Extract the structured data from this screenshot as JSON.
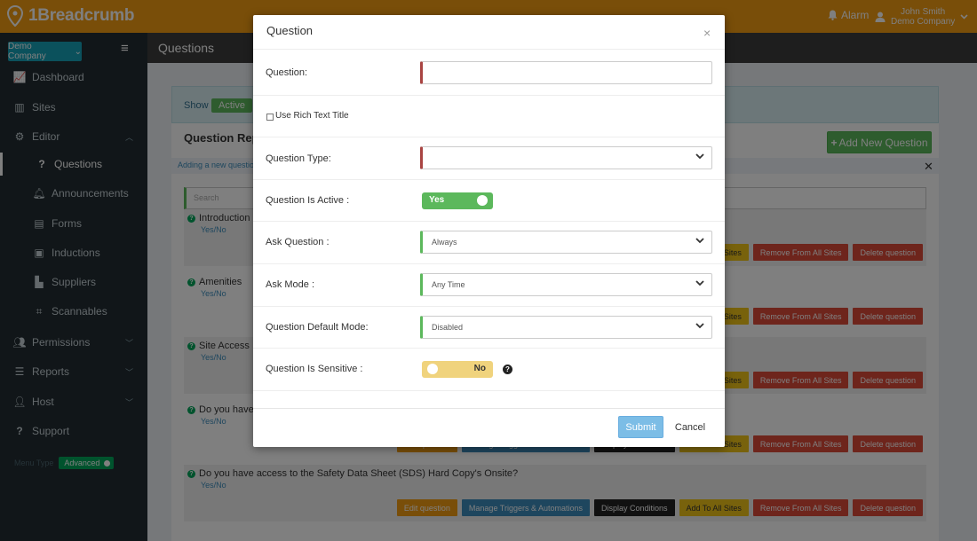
{
  "app": {
    "logo_text": "1Breadcrumb",
    "alarm_label": "Alarm",
    "user_name": "John Smith",
    "user_company": "Demo Company",
    "brand_color": "#f39c12"
  },
  "sidebar": {
    "company_selector": "Demo Company",
    "items": [
      {
        "label": "Dashboard",
        "icon": "chart-icon"
      },
      {
        "label": "Sites",
        "icon": "building-icon"
      },
      {
        "label": "Editor",
        "icon": "gear-icon"
      },
      {
        "label": "Questions",
        "icon": "question-icon"
      },
      {
        "label": "Announcements",
        "icon": "bell-icon"
      },
      {
        "label": "Forms",
        "icon": "file-icon"
      },
      {
        "label": "Inductions",
        "icon": "id-card-icon"
      },
      {
        "label": "Suppliers",
        "icon": "industry-icon"
      },
      {
        "label": "Scannables",
        "icon": "qrcode-icon"
      },
      {
        "label": "Permissions",
        "icon": "users-icon"
      },
      {
        "label": "Reports",
        "icon": "list-icon"
      },
      {
        "label": "Host",
        "icon": "user-gear-icon"
      },
      {
        "label": "Support",
        "icon": "question-mark-icon"
      }
    ],
    "menu_type_label": "Menu Type",
    "menu_type_value": "Advanced"
  },
  "page": {
    "title": "Questions",
    "show_label": "Show",
    "active_filter": "Active",
    "report_title": "Question Rep",
    "add_new_button": "Add New Question",
    "adding_notice": "Adding a new question",
    "search_placeholder": "Search",
    "questions": [
      {
        "text": "Introduction",
        "type": "Yes/No"
      },
      {
        "text": "Amenities",
        "type": "Yes/No"
      },
      {
        "text": "Site Access",
        "type": "Yes/No"
      },
      {
        "text": "Do you have",
        "type": "Yes/No"
      },
      {
        "text": "Do you have access to the Safety Data Sheet (SDS) Hard Copy's Onsite?",
        "type": "Yes/No"
      }
    ],
    "row_buttons": {
      "edit": "Edit question",
      "triggers": "Manage Triggers & Automations",
      "conditions": "Display Conditions",
      "add_all": "Add To All Sites",
      "add_all_partial": "All Sites",
      "remove_all": "Remove From All Sites",
      "delete": "Delete question"
    }
  },
  "modal": {
    "title": "Question",
    "fields": {
      "question_label": "Question:",
      "question_value": "",
      "rich_text_label": "Use Rich Text Title",
      "rich_text_checked": false,
      "type_label": "Question Type:",
      "type_value": "",
      "active_label": "Question Is Active :",
      "active_value": "Yes",
      "ask_label": "Ask Question :",
      "ask_value": "Always",
      "mode_label": "Ask Mode :",
      "mode_value": "Any Time",
      "default_mode_label": "Question Default Mode:",
      "default_mode_value": "Disabled",
      "sensitive_label": "Question Is Sensitive :",
      "sensitive_value": "No"
    },
    "submit": "Submit",
    "cancel": "Cancel"
  }
}
